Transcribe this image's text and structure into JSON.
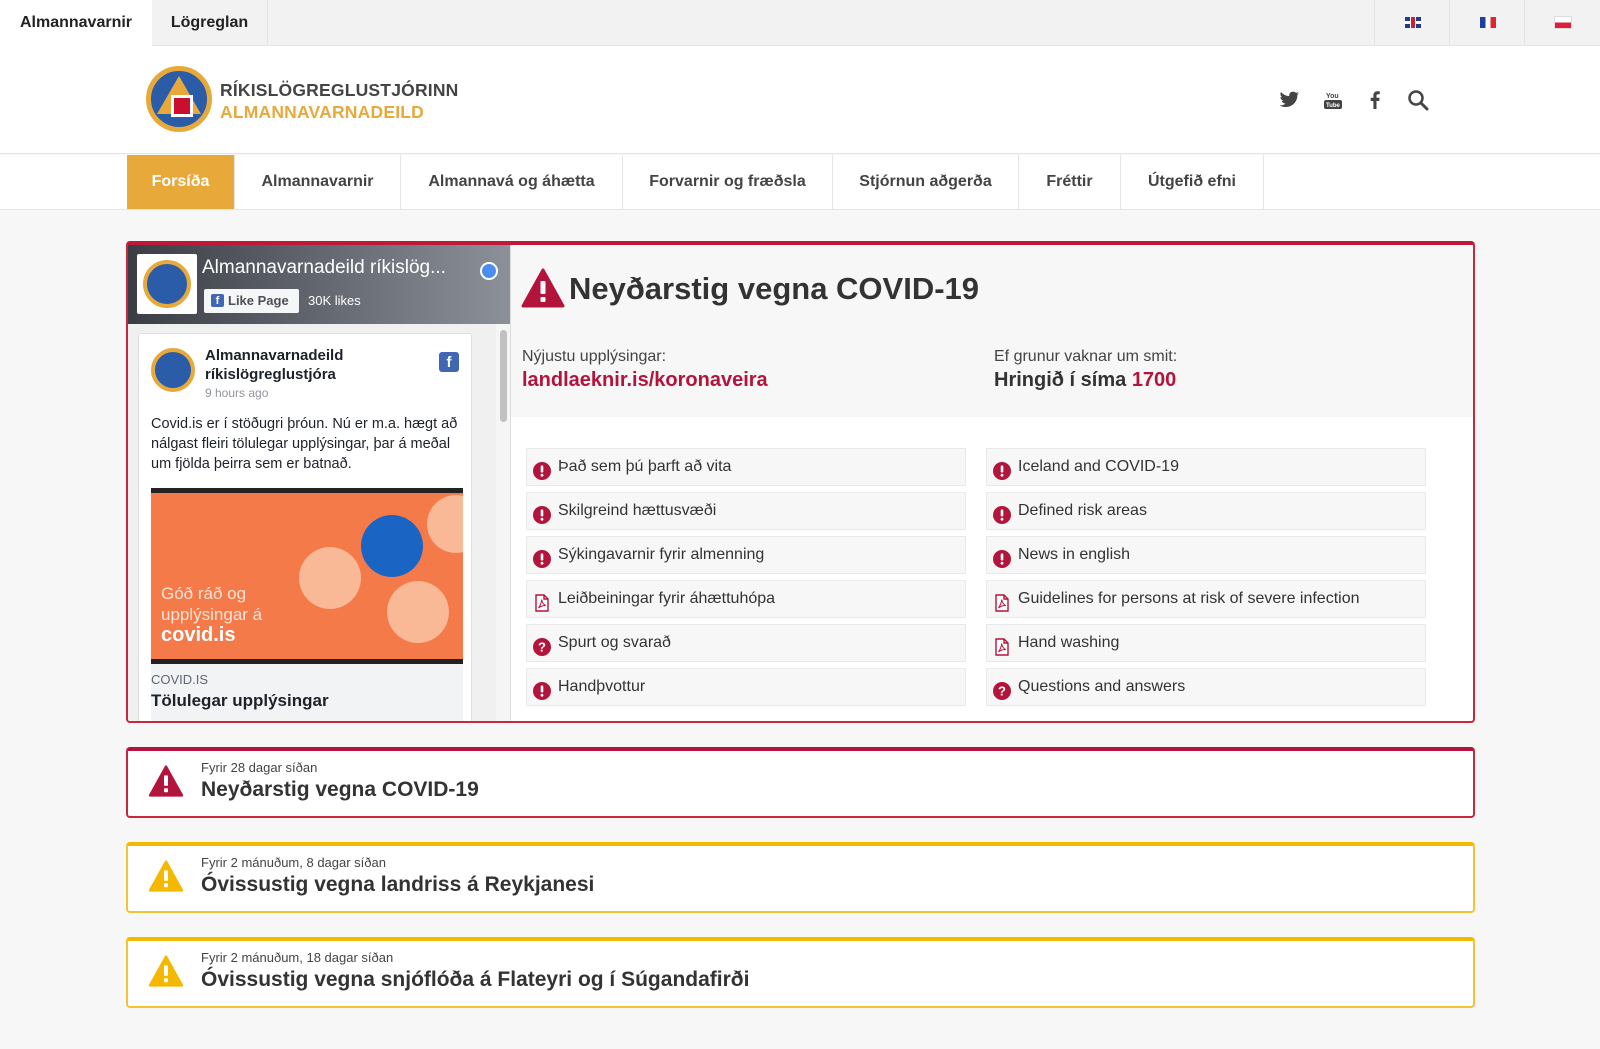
{
  "topbar": {
    "tabs": [
      "Almannavarnir",
      "Lögreglan"
    ],
    "languages": [
      "English",
      "Français",
      "Polski"
    ]
  },
  "header": {
    "brand_line1": "RÍKISLÖGREGLUSTJÓRINN",
    "brand_line2": "ALMANNAVARNADEILD",
    "brand_color": "#e8a93b",
    "social_icons": [
      "twitter-icon",
      "youtube-icon",
      "facebook-icon",
      "search-icon"
    ]
  },
  "nav": {
    "items": [
      "Forsíða",
      "Almannavarnir",
      "Almannavá og áhætta",
      "Forvarnir og fræðsla",
      "Stjórnun aðgerða",
      "Fréttir",
      "Útgefið efni"
    ],
    "active_color": "#e8a93b"
  },
  "facebook": {
    "page_name": "Almannavarnadeild ríkislög...",
    "like_label": "Like Page",
    "likes": "30K likes",
    "post_author": "Almannavarnadeild ríkislögreglustjóra",
    "post_time": "9 hours ago",
    "post_text": "Covid.is er í stöðugri þróun. Nú er m.a. hægt að nálgast fleiri tölulegar upplýsingar, þar á meðal um fjölda þeirra sem er batnað.",
    "image_text_line1": "Góð ráð og",
    "image_text_line2": "upplýsingar á",
    "image_text_line3": "covid.is",
    "link_domain": "COVID.IS",
    "link_title": "Tölulegar upplýsingar"
  },
  "alert": {
    "title": "Neyðarstig vegna COVID-19",
    "latest_label": "Nýjustu upplýsingar:",
    "latest_link": "landlaeknir.is/koronaveira",
    "suspect_label": "Ef grunur vaknar um smit:",
    "suspect_text": "Hringið í síma",
    "suspect_phone": "1700",
    "accent_color": "#b3143c",
    "links_left": [
      {
        "label": "Það sem þú þarft að vita",
        "icon": "exclamation-icon"
      },
      {
        "label": "Skilgreind hættusvæði",
        "icon": "exclamation-icon"
      },
      {
        "label": "Sýkingavarnir fyrir almenning",
        "icon": "exclamation-icon"
      },
      {
        "label": "Leiðbeiningar fyrir áhættuhópa",
        "icon": "pdf-icon"
      },
      {
        "label": "Spurt og svarað",
        "icon": "question-icon"
      },
      {
        "label": "Handþvottur",
        "icon": "exclamation-icon"
      }
    ],
    "links_right": [
      {
        "label": "Iceland and COVID-19",
        "icon": "exclamation-icon"
      },
      {
        "label": "Defined risk areas",
        "icon": "exclamation-icon"
      },
      {
        "label": "News in english",
        "icon": "exclamation-icon"
      },
      {
        "label": "Guidelines for persons at risk of severe infection",
        "icon": "pdf-icon"
      },
      {
        "label": "Hand washing",
        "icon": "pdf-icon"
      },
      {
        "label": "Questions and answers",
        "icon": "question-icon"
      }
    ]
  },
  "recent": [
    {
      "date": "Fyrir 28 dagar síðan",
      "title": "Neyðarstig vegna COVID-19",
      "level": "red"
    },
    {
      "date": "Fyrir 2 mánuðum, 8 dagar síðan",
      "title": "Óvissustig vegna landriss á Reykjanesi",
      "level": "yellow"
    },
    {
      "date": "Fyrir 2 mánuðum, 18 dagar síðan",
      "title": "Óvissustig vegna snjóflóða á Flateyri og í Súgandafirði",
      "level": "yellow"
    }
  ],
  "colors": {
    "red": "#b3143c",
    "yellow": "#f5b800"
  }
}
